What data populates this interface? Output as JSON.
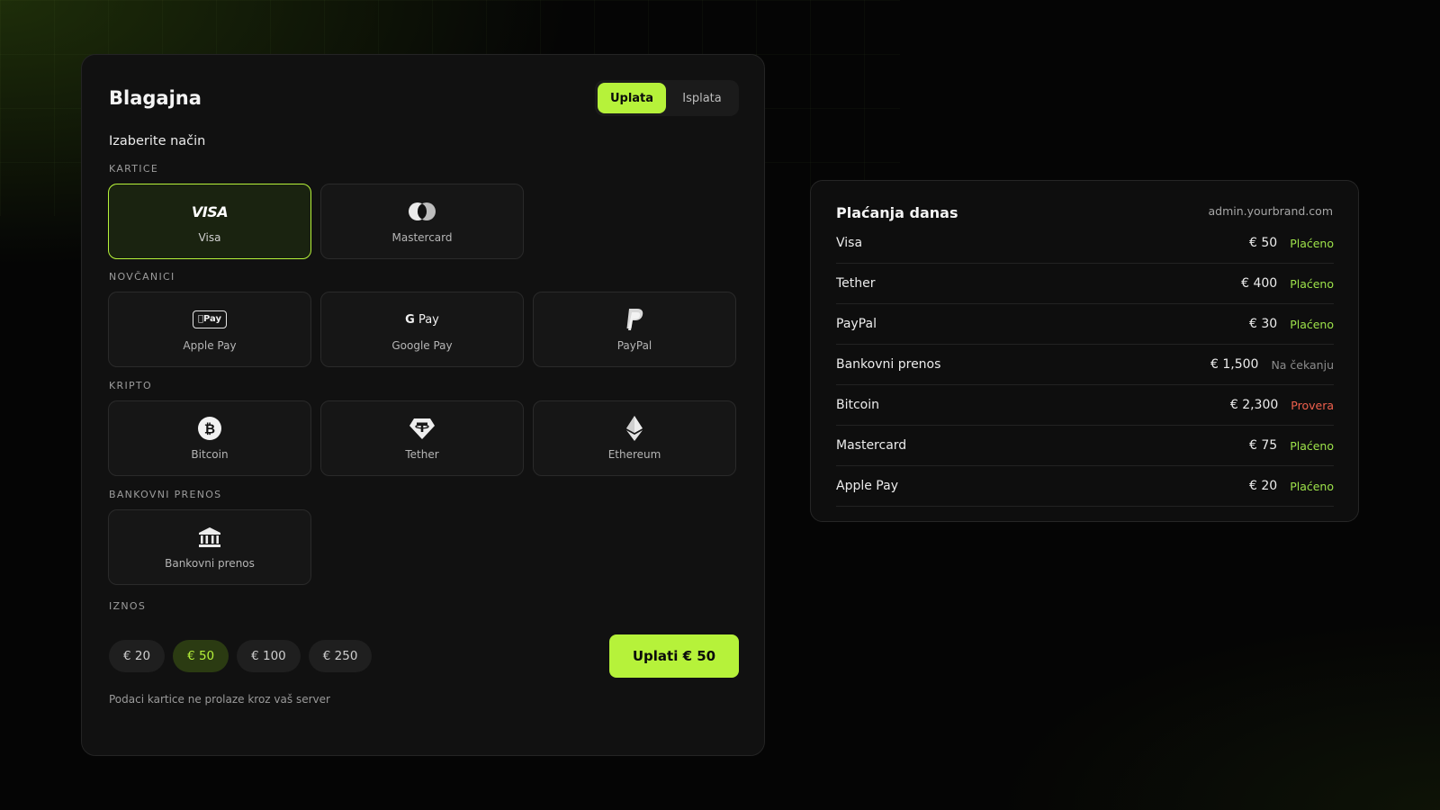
{
  "colors": {
    "accent": "#b6f23a",
    "status_paid": "#9ee34a",
    "status_pending": "#8c8c8c",
    "status_review": "#f0604d"
  },
  "cashier": {
    "title": "Blagajna",
    "tabs": [
      {
        "label": "Uplata",
        "active": true
      },
      {
        "label": "Isplata",
        "active": false
      }
    ],
    "subtitle": "Izaberite način",
    "sections": {
      "cards": {
        "label": "KARTICE",
        "items": [
          {
            "label": "Visa",
            "icon": "visa-logo",
            "icon_text": "VISA",
            "selected": true
          },
          {
            "label": "Mastercard",
            "icon": "mastercard-icon",
            "selected": false
          }
        ]
      },
      "wallets": {
        "label": "NOVČANICI",
        "items": [
          {
            "label": "Apple Pay",
            "icon": "apple-pay-icon",
            "icon_text": "Pay"
          },
          {
            "label": "Google Pay",
            "icon": "google-pay-icon",
            "icon_text_g": "G",
            "icon_text": "Pay"
          },
          {
            "label": "PayPal",
            "icon": "paypal-icon"
          }
        ]
      },
      "crypto": {
        "label": "KRIPTO",
        "items": [
          {
            "label": "Bitcoin",
            "icon": "bitcoin-icon"
          },
          {
            "label": "Tether",
            "icon": "tether-icon"
          },
          {
            "label": "Ethereum",
            "icon": "ethereum-icon"
          }
        ]
      },
      "bank": {
        "label": "BANKOVNI PRENOS",
        "items": [
          {
            "label": "Bankovni prenos",
            "icon": "bank-icon"
          }
        ]
      }
    },
    "amount": {
      "label": "IZNOS",
      "options": [
        "€ 20",
        "€ 50",
        "€ 100",
        "€ 250"
      ],
      "selected": "€ 50"
    },
    "pay_button": "Uplati € 50",
    "footnote": "Podaci kartice ne prolaze kroz vaš server"
  },
  "payments_today": {
    "title": "Plaćanja danas",
    "domain": "admin.yourbrand.com",
    "rows": [
      {
        "name": "Visa",
        "amount": "€ 50",
        "status": "Plaćeno",
        "status_type": "paid"
      },
      {
        "name": "Tether",
        "amount": "€ 400",
        "status": "Plaćeno",
        "status_type": "paid"
      },
      {
        "name": "PayPal",
        "amount": "€ 30",
        "status": "Plaćeno",
        "status_type": "paid"
      },
      {
        "name": "Bankovni prenos",
        "amount": "€ 1,500",
        "status": "Na čekanju",
        "status_type": "pending"
      },
      {
        "name": "Bitcoin",
        "amount": "€ 2,300",
        "status": "Provera",
        "status_type": "review"
      },
      {
        "name": "Mastercard",
        "amount": "€ 75",
        "status": "Plaćeno",
        "status_type": "paid"
      },
      {
        "name": "Apple Pay",
        "amount": "€ 20",
        "status": "Plaćeno",
        "status_type": "paid"
      }
    ]
  }
}
